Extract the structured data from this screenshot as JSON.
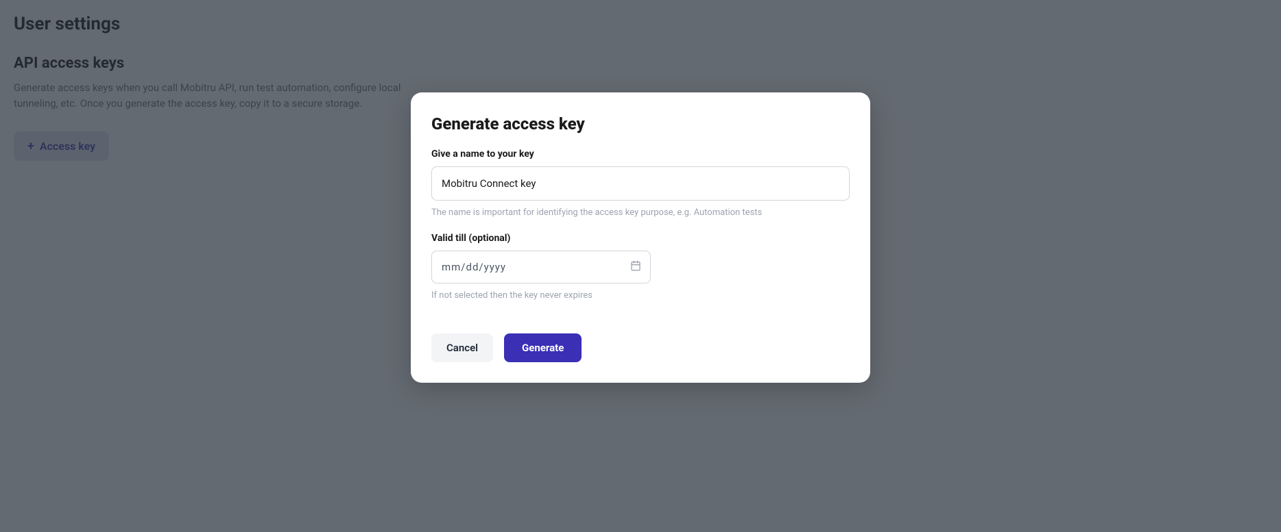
{
  "page": {
    "title": "User settings",
    "section": {
      "title": "API access keys",
      "description": "Generate access keys when you call Mobitru API, run test automation, configure local tunneling, etc. Once you generate the access key, copy it to a secure storage.",
      "new_key_button_label": "Access key"
    }
  },
  "dialog": {
    "title": "Generate access key",
    "name_field": {
      "label": "Give a name to your key",
      "value": "Mobitru Connect key",
      "helper": "The name is important for identifying the access key purpose, e.g. Automation tests"
    },
    "valid_till_field": {
      "label": "Valid till (optional)",
      "placeholder": "mm/dd/yyyy",
      "helper": "If not selected then the key never expires"
    },
    "actions": {
      "cancel_label": "Cancel",
      "generate_label": "Generate"
    }
  }
}
